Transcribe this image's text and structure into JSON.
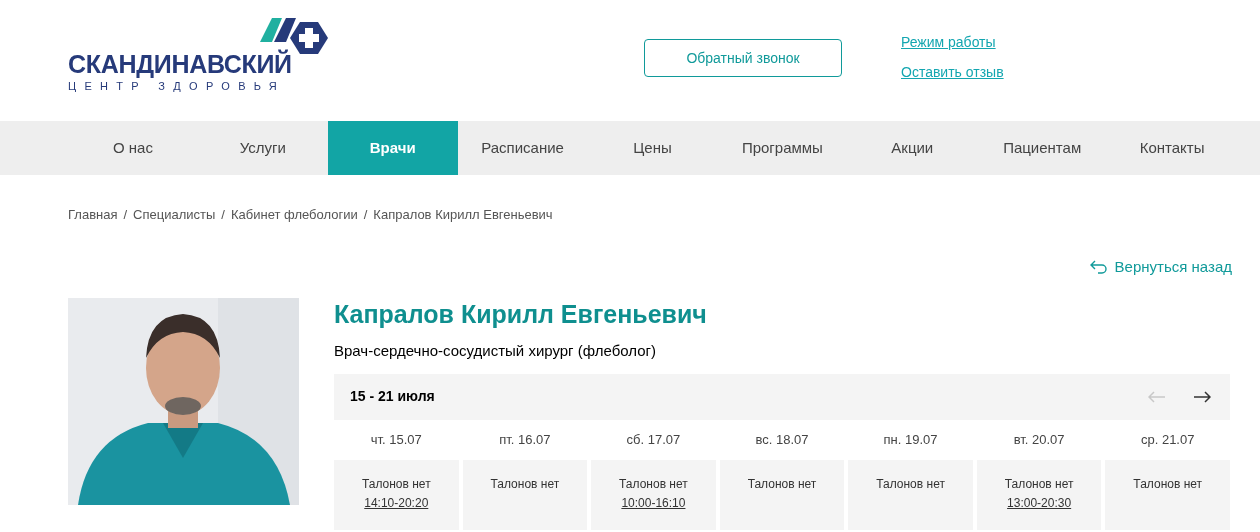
{
  "logo": {
    "name": "СКАНДИНАВСКИЙ",
    "tagline": "ЦЕНТР ЗДОРОВЬЯ"
  },
  "header": {
    "callback_button": "Обратный звонок",
    "links": [
      "Режим работы",
      "Оставить отзыв"
    ]
  },
  "nav": [
    {
      "label": "О нас",
      "selected": false
    },
    {
      "label": "Услуги",
      "selected": false
    },
    {
      "label": "Врачи",
      "selected": true
    },
    {
      "label": "Расписание",
      "selected": false
    },
    {
      "label": "Цены",
      "selected": false
    },
    {
      "label": "Программы",
      "selected": false
    },
    {
      "label": "Акции",
      "selected": false
    },
    {
      "label": "Пациентам",
      "selected": false
    },
    {
      "label": "Контакты",
      "selected": false
    }
  ],
  "breadcrumbs": [
    {
      "kind": "link",
      "text": "Главная"
    },
    {
      "kind": "separator",
      "text": "/"
    },
    {
      "kind": "link",
      "text": "Специалисты"
    },
    {
      "kind": "separator",
      "text": "/"
    },
    {
      "kind": "link",
      "text": "Кабинет флебологии"
    },
    {
      "kind": "separator",
      "text": "/"
    },
    {
      "kind": "current",
      "text": "Капралов Кирилл Евгеньевич"
    }
  ],
  "back_link": "Вернуться назад",
  "doctor": {
    "name": "Капралов Кирилл Евгеньевич",
    "specialty": "Врач-сердечно-сосудистый хирург (флеболог)"
  },
  "schedule": {
    "week": "15 - 21 июля",
    "prev": {
      "disabled": true
    },
    "next": {
      "disabled": false
    },
    "days": [
      {
        "date": "чт. 15.07",
        "status": "Талонов нет",
        "hours": "14:10-20:20"
      },
      {
        "date": "пт. 16.07",
        "status": "Талонов нет"
      },
      {
        "date": "сб. 17.07",
        "status": "Талонов нет",
        "hours": "10:00-16:10"
      },
      {
        "date": "вс. 18.07",
        "status": "Талонов нет"
      },
      {
        "date": "пн. 19.07",
        "status": "Талонов нет"
      },
      {
        "date": "вт. 20.07",
        "status": "Талонов нет",
        "hours": "13:00-20:30"
      },
      {
        "date": "ср. 21.07",
        "status": "Талонов нет"
      }
    ]
  }
}
